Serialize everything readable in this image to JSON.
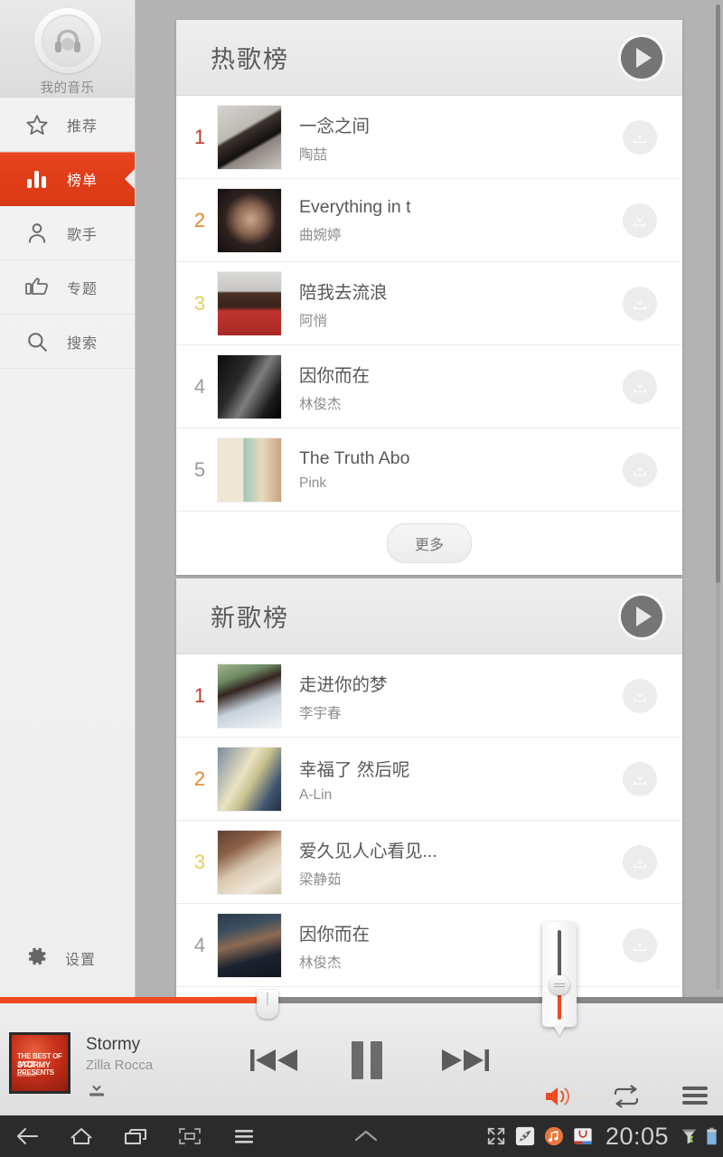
{
  "sidebar": {
    "header": {
      "label": "我的音乐",
      "icon": "headphones-icon"
    },
    "items": [
      {
        "label": "推荐",
        "icon": "star-icon",
        "active": false
      },
      {
        "label": "榜单",
        "icon": "bar-chart-icon",
        "active": true
      },
      {
        "label": "歌手",
        "icon": "person-icon",
        "active": false
      },
      {
        "label": "专题",
        "icon": "thumbs-up-icon",
        "active": false
      },
      {
        "label": "搜索",
        "icon": "search-icon",
        "active": false
      }
    ],
    "settings": {
      "label": "设置",
      "icon": "gear-icon"
    }
  },
  "main": {
    "sections": [
      {
        "title": "热歌榜",
        "play_icon": "play-icon",
        "more_label": "更多",
        "rows": [
          {
            "rank": "1",
            "rank_color": "#c0392b",
            "song": "一念之间",
            "artist": "陶喆"
          },
          {
            "rank": "2",
            "rank_color": "#e08a2e",
            "song": "Everything in t",
            "artist": "曲婉婷"
          },
          {
            "rank": "3",
            "rank_color": "#e3cf5e",
            "song": "陪我去流浪",
            "artist": "阿悄"
          },
          {
            "rank": "4",
            "rank_color": "#9b9b9b",
            "song": "因你而在",
            "artist": "林俊杰"
          },
          {
            "rank": "5",
            "rank_color": "#9b9b9b",
            "song": "The Truth Abo",
            "artist": "Pink"
          }
        ]
      },
      {
        "title": "新歌榜",
        "play_icon": "play-icon",
        "rows": [
          {
            "rank": "1",
            "rank_color": "#c0392b",
            "song": "走进你的梦",
            "artist": "李宇春"
          },
          {
            "rank": "2",
            "rank_color": "#e08a2e",
            "song": "幸福了 然后呢",
            "artist": "A-Lin"
          },
          {
            "rank": "3",
            "rank_color": "#e3cf5e",
            "song": "爱久见人心看见...",
            "artist": "梁静茹"
          },
          {
            "rank": "4",
            "rank_color": "#9b9b9b",
            "song": "因你而在",
            "artist": "林俊杰"
          }
        ]
      }
    ]
  },
  "player": {
    "track_title": "Stormy",
    "track_artist": "Zilla Rocca",
    "album_art_line1": "THE BEST OF JAZZ PRESENTS",
    "album_art_line2": "STORMY",
    "album_art_line3": "MONDAY",
    "download_icon": "download-icon",
    "prev_icon": "previous-track-icon",
    "play_icon": "pause-icon",
    "next_icon": "next-track-icon",
    "volume_icon": "volume-icon",
    "repeat_icon": "repeat-icon",
    "playlist_icon": "playlist-icon",
    "progress_percent": 37,
    "volume_percent": 30,
    "accent_color": "#ef4b22"
  },
  "navbar": {
    "back_icon": "back-arrow-icon",
    "home_icon": "home-icon",
    "recents_icon": "recent-apps-icon",
    "screenshot_icon": "screenshot-icon",
    "menu_icon": "menu-icon",
    "collapse_icon": "collapse-chevron-icon",
    "expand_icon": "fullscreen-icon",
    "clock": "20:05",
    "tray_icons": [
      "pea-app-icon",
      "music-app-icon",
      "market-app-icon",
      "signal-icon",
      "battery-icon"
    ]
  }
}
